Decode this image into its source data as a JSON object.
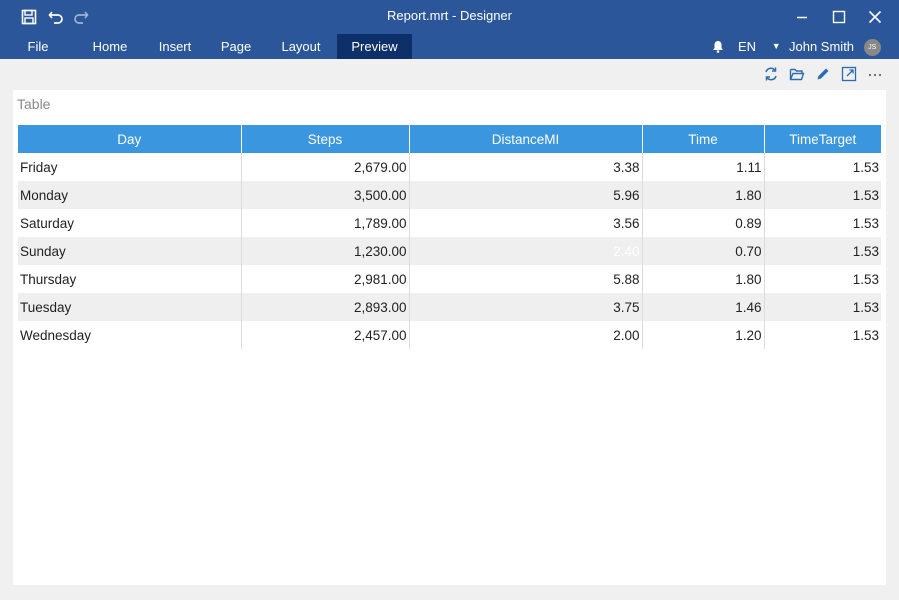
{
  "window": {
    "title": "Report.mrt - Designer"
  },
  "menu": {
    "items": [
      "File",
      "Home",
      "Insert",
      "Page",
      "Layout",
      "Preview"
    ],
    "active": "Preview",
    "language": "EN",
    "user_name": "John Smith",
    "user_initials": "JS"
  },
  "report": {
    "label": "Table",
    "columns": [
      "Day",
      "Steps",
      "DistanceMI",
      "Time",
      "TimeTarget"
    ],
    "rows": [
      [
        "Friday",
        "2,679.00",
        "3.38",
        "1.11",
        "1.53"
      ],
      [
        "Monday",
        "3,500.00",
        "5.96",
        "1.80",
        "1.53"
      ],
      [
        "Saturday",
        "1,789.00",
        "3.56",
        "0.89",
        "1.53"
      ],
      [
        "Sunday",
        "1,230.00",
        "2.40",
        "0.70",
        "1.53"
      ],
      [
        "Thursday",
        "2,981.00",
        "5.88",
        "1.80",
        "1.53"
      ],
      [
        "Tuesday",
        "2,893.00",
        "3.75",
        "1.46",
        "1.53"
      ],
      [
        "Wednesday",
        "2,457.00",
        "2.00",
        "1.20",
        "1.53"
      ]
    ]
  },
  "colors": {
    "accent": "#2b579a",
    "active_tab": "#0d2f6a",
    "header": "#3b96e0",
    "selected_cell": "#5ab2f0"
  },
  "icons": {
    "toolbar": [
      "refresh-icon",
      "open-folder-icon",
      "edit-icon",
      "fullscreen-icon",
      "more-icon"
    ]
  }
}
